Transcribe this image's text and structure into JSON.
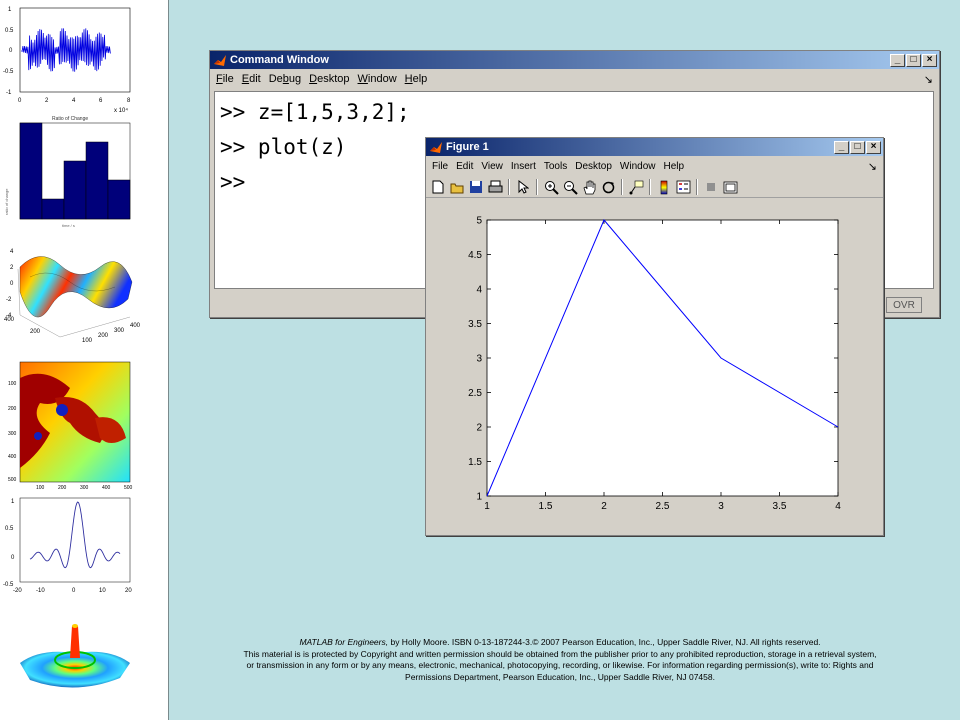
{
  "footer": {
    "book_title": "MATLAB for Engineers,",
    "line1_rest": " by Holly Moore. ISBN 0-13-187244-3.© 2007 Pearson Education, Inc., Upper Saddle River, NJ.  All rights reserved.",
    "line2": "This material is is protected by Copyright and written permission should be obtained from the publisher prior to any prohibited reproduction, storage in a retrieval system, or transmission in any form or by any means, electronic, mechanical, photocopying, recording, or likewise. For information regarding permission(s), write to: Rights and Permissions Department, Pearson Education, Inc., Upper Saddle River, NJ 07458."
  },
  "sidebar": {
    "thumb1": {
      "yticks": [
        "1",
        "0.5",
        "0",
        "-0.5",
        "-1"
      ],
      "xticks": [
        "0",
        "2",
        "4",
        "6",
        "8"
      ],
      "exponent": "x 10⁴"
    },
    "thumb2": {
      "title": "Ratio of Change"
    },
    "thumb3": {
      "zticks": [
        "4",
        "2",
        "0",
        "-2",
        "-4"
      ],
      "ticks_a": [
        "400",
        "200"
      ],
      "ticks_b": [
        "400",
        "300",
        "200",
        "100"
      ]
    },
    "thumb4": {
      "yticks": [
        "100",
        "200",
        "300",
        "400",
        "500"
      ],
      "xticks": [
        "100",
        "200",
        "300",
        "400",
        "500"
      ]
    },
    "thumb5": {
      "yticks": [
        "1",
        "0.5",
        "0",
        "-0.5"
      ],
      "xticks": [
        "-20",
        "-10",
        "0",
        "10",
        "20"
      ]
    }
  },
  "command_window": {
    "title": "Command Window",
    "menus": [
      {
        "first": "F",
        "rest": "ile"
      },
      {
        "first": "E",
        "rest": "dit"
      },
      {
        "first": "",
        "pre": "De",
        "mid": "b",
        "rest": "ug"
      },
      {
        "first": "D",
        "rest": "esktop"
      },
      {
        "first": "W",
        "rest": "indow"
      },
      {
        "first": "H",
        "rest": "elp"
      }
    ],
    "lines": [
      ">> z=[1,5,3,2];",
      ">> plot(z)",
      ">>"
    ],
    "status": "OVR"
  },
  "figure_window": {
    "title": "Figure 1",
    "menus": [
      "File",
      "Edit",
      "View",
      "Insert",
      "Tools",
      "Desktop",
      "Window",
      "Help"
    ]
  },
  "chart_data": {
    "type": "line",
    "x": [
      1,
      2,
      3,
      4
    ],
    "series": [
      {
        "values": [
          1,
          5,
          3,
          2
        ]
      }
    ],
    "xlim": [
      1,
      4
    ],
    "ylim": [
      1,
      5
    ],
    "xticks": [
      "1",
      "1.5",
      "2",
      "2.5",
      "3",
      "3.5",
      "4"
    ],
    "yticks": [
      "1",
      "1.5",
      "2",
      "2.5",
      "3",
      "3.5",
      "4",
      "4.5",
      "5"
    ],
    "line_color": "#0000ff",
    "grid": false
  }
}
